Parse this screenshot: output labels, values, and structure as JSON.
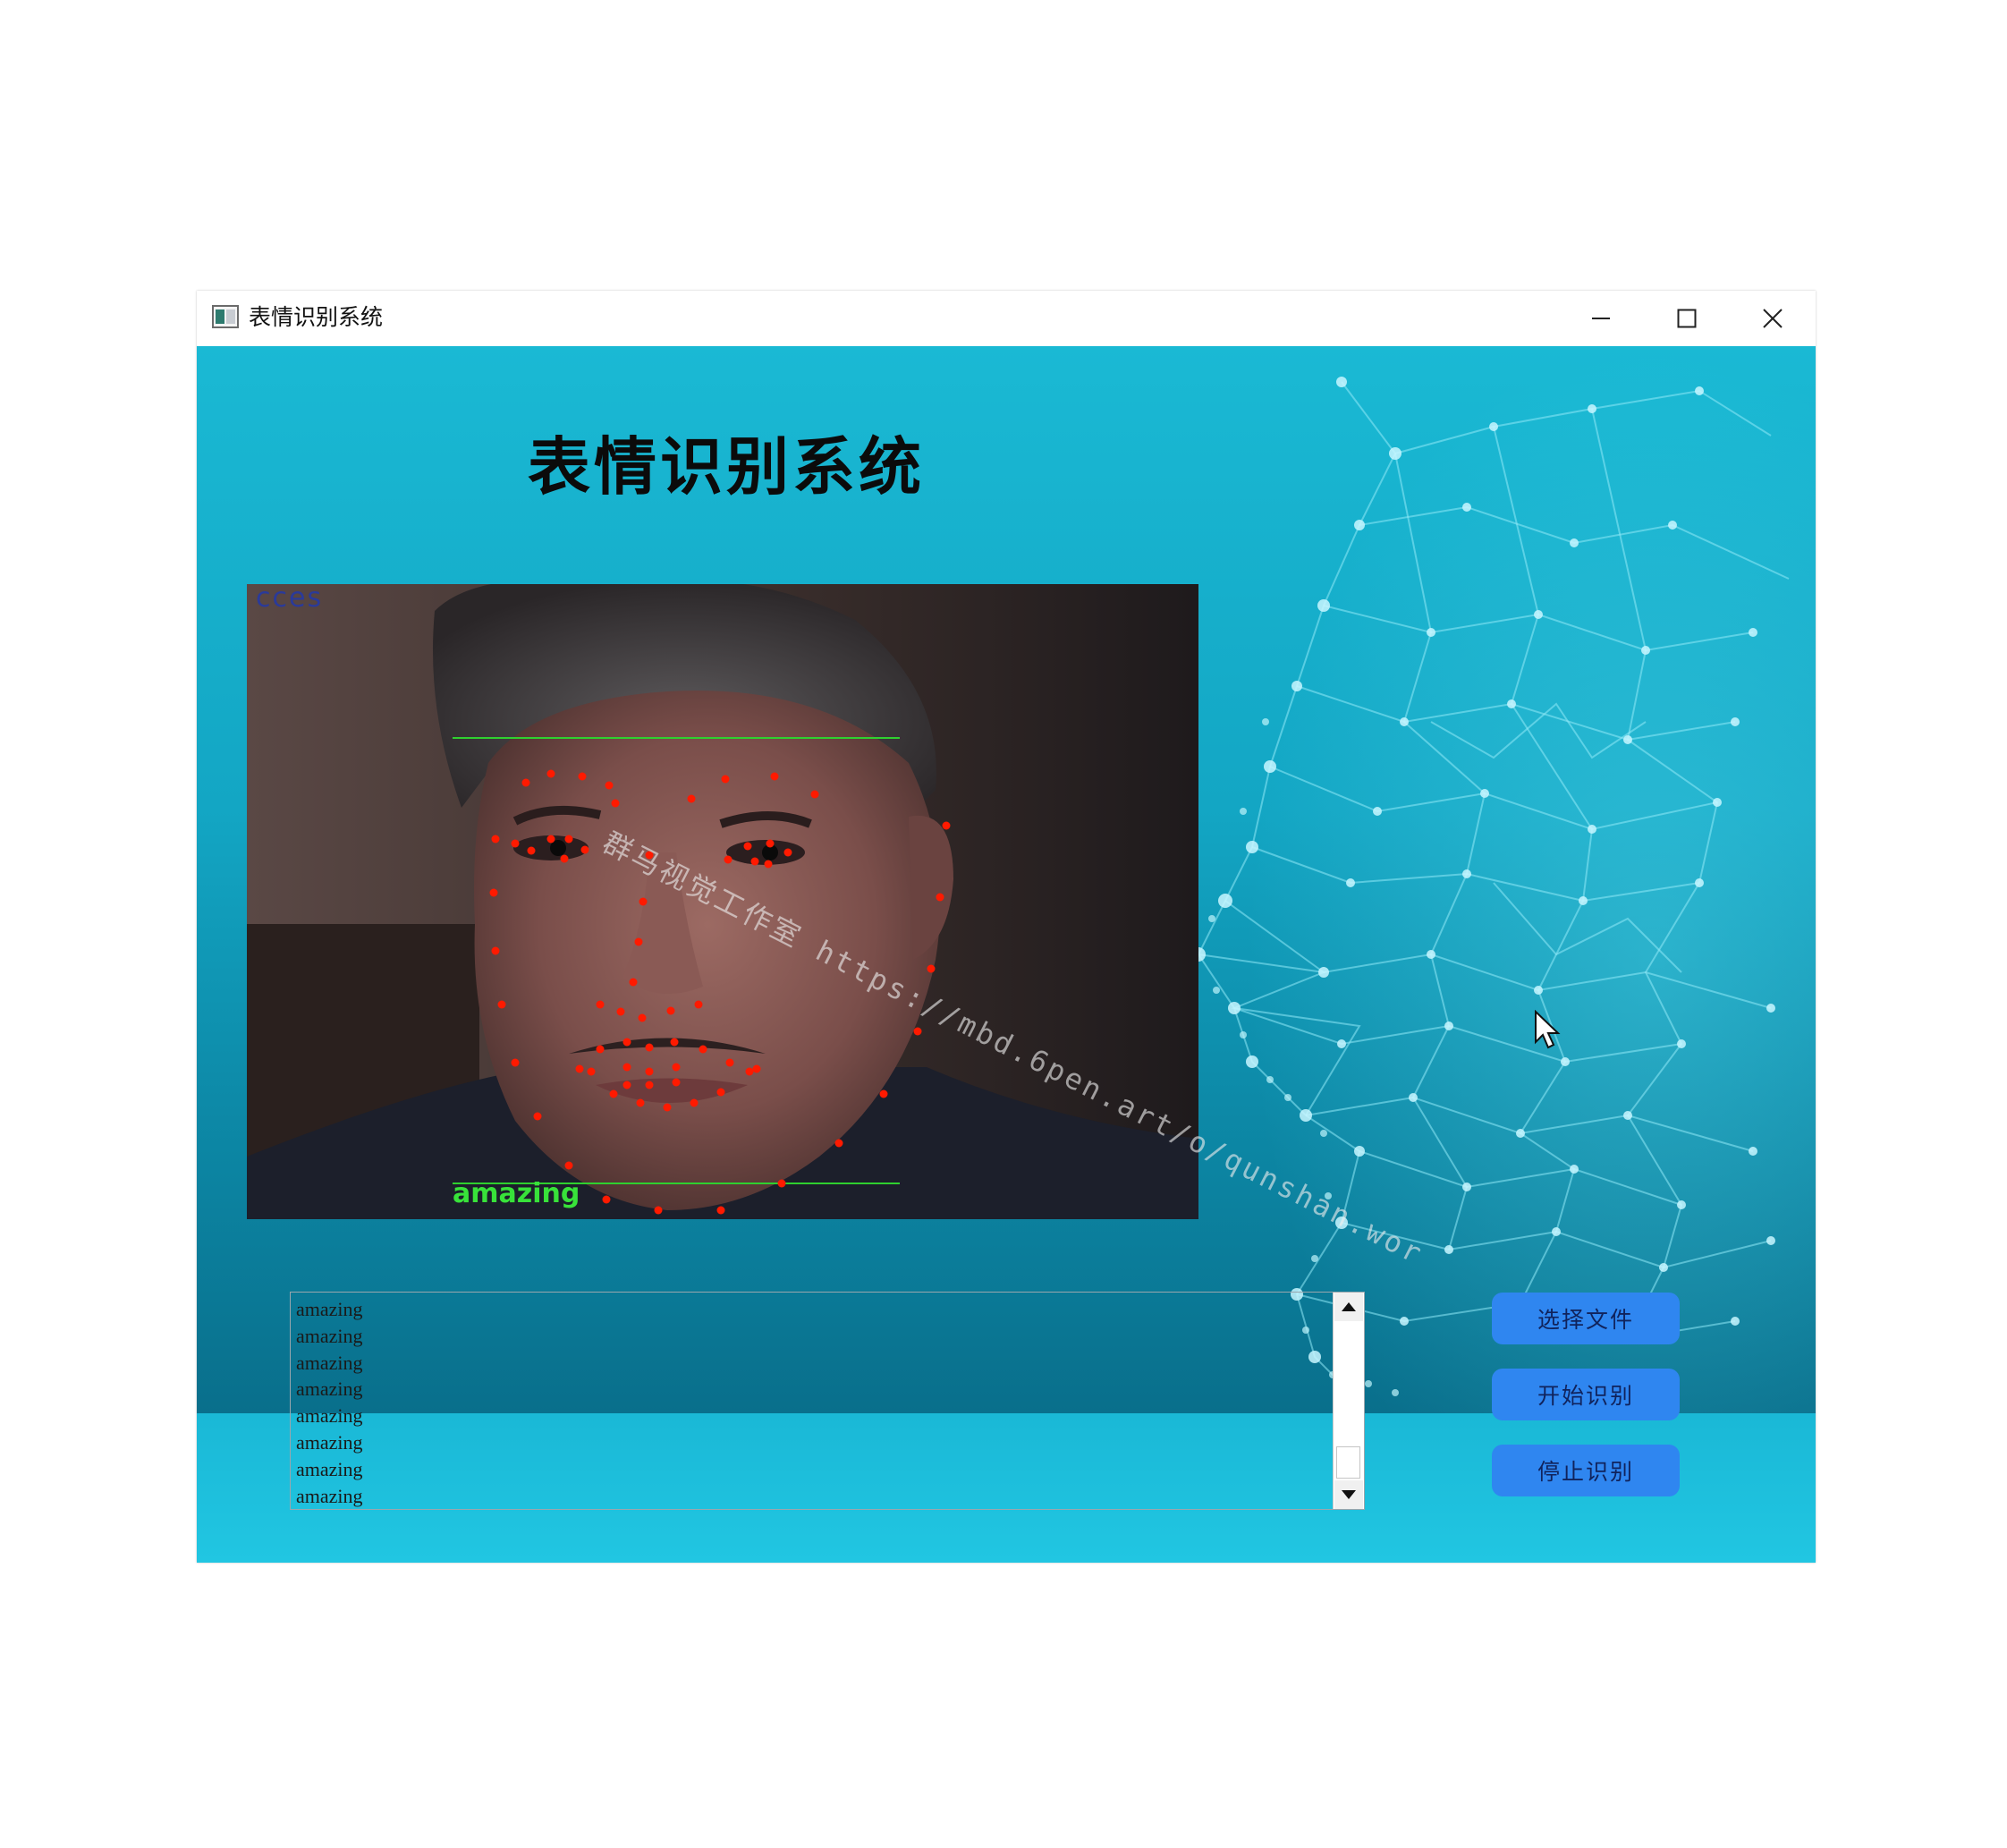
{
  "window": {
    "title": "表情识别系统",
    "controls": {
      "minimize": "minimize",
      "maximize": "maximize",
      "close": "close"
    }
  },
  "main": {
    "heading": "表情识别系统",
    "video": {
      "top_overlay_text": "cces",
      "emotion_label": "amazing",
      "watermark": "群马视觉工作室 https://mbd.6pen.art/o/qunshan.wor"
    },
    "log": {
      "lines": [
        "amazing",
        "amazing",
        "amazing",
        "amazing",
        "amazing",
        "amazing",
        "amazing",
        "amazing"
      ]
    },
    "buttons": {
      "select_file": "选择文件",
      "start": "开始识别",
      "stop": "停止识别"
    }
  },
  "colors": {
    "background_top": "#1ab9d4",
    "background_bottom": "#07627e",
    "button": "#2f86f0",
    "landmark": "#ff1a00",
    "label": "#38e23a"
  }
}
